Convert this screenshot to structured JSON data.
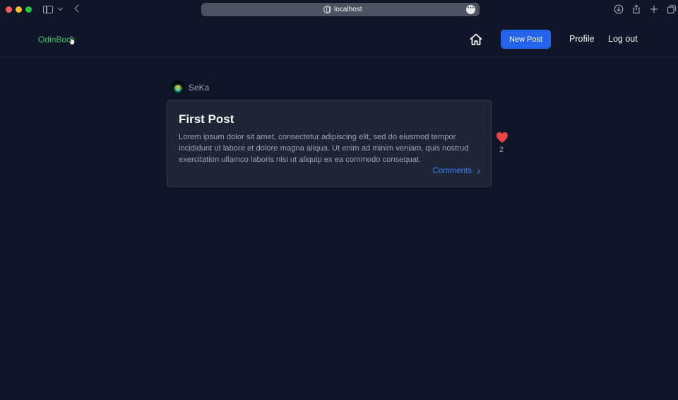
{
  "browser": {
    "url": "localhost",
    "more_icon": "ellipsis-icon",
    "traffic_colors": [
      "#ff5f57",
      "#febc2e",
      "#28c840"
    ]
  },
  "nav": {
    "brand": "OdinBook",
    "home_icon": "home-icon",
    "new_post_label": "New Post",
    "profile_label": "Profile",
    "logout_label": "Log out"
  },
  "post": {
    "author": "SeKa",
    "title": "First Post",
    "body": "Lorem ipsum dolor sit amet, consectetur adipiscing elit, sed do eiusmod tempor incididunt ut labore et dolore magna aliqua. Ut enim ad minim veniam, quis nostrud exercitation ullamco laboris nisi ut aliquip ex ea commodo consequat.",
    "comments_label": "Comments",
    "likes": "2"
  },
  "colors": {
    "background": "#0f1629",
    "accent": "#2563eb",
    "brand": "#3fc46a",
    "link": "#3b82f6",
    "heart": "#ef4444"
  }
}
